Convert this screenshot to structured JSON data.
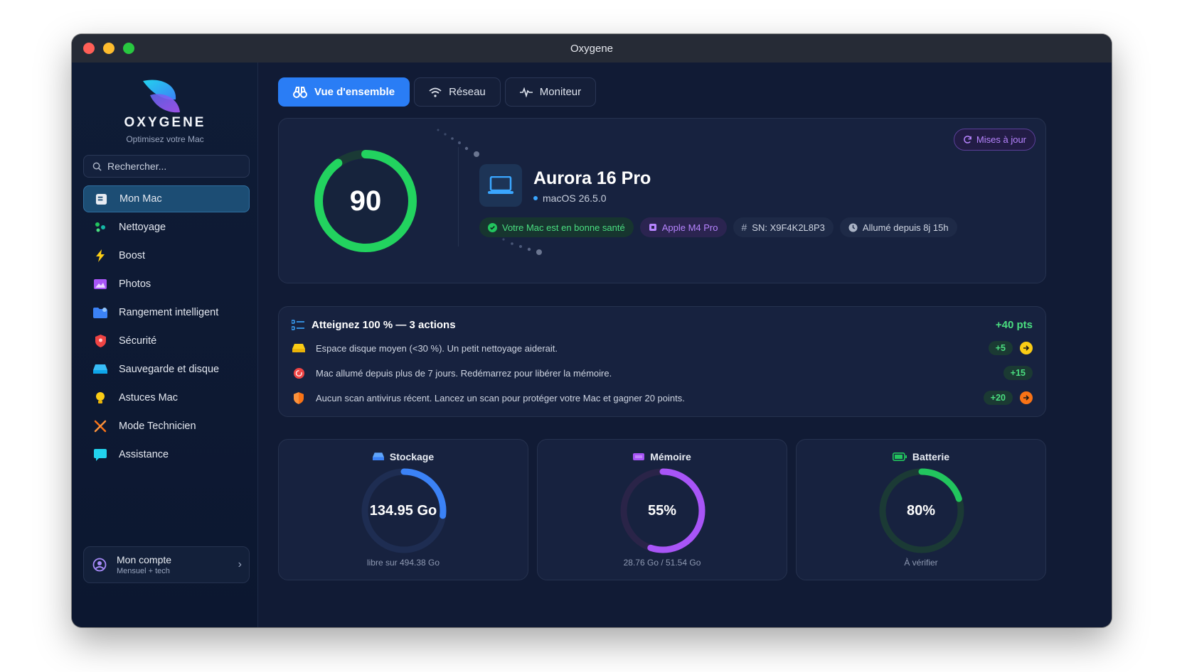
{
  "window": {
    "title": "Oxygene"
  },
  "sidebar": {
    "brand": "OXYGENE",
    "tagline": "Optimisez votre Mac",
    "search_placeholder": "Rechercher...",
    "items": [
      {
        "label": "Mon Mac",
        "icon": "mac-icon",
        "active": true
      },
      {
        "label": "Nettoyage",
        "icon": "sparkle-icon"
      },
      {
        "label": "Boost",
        "icon": "lightning-icon"
      },
      {
        "label": "Photos",
        "icon": "photo-icon"
      },
      {
        "label": "Rangement intelligent",
        "icon": "folder-icon"
      },
      {
        "label": "Sécurité",
        "icon": "shield-icon"
      },
      {
        "label": "Sauvegarde et disque",
        "icon": "disk-icon"
      },
      {
        "label": "Astuces Mac",
        "icon": "bulb-icon"
      },
      {
        "label": "Mode Technicien",
        "icon": "tools-icon"
      },
      {
        "label": "Assistance",
        "icon": "chat-icon"
      }
    ],
    "account": {
      "name": "Mon compte",
      "plan": "Mensuel + tech"
    }
  },
  "tabs": [
    {
      "label": "Vue d'ensemble",
      "active": true
    },
    {
      "label": "Réseau"
    },
    {
      "label": "Moniteur"
    }
  ],
  "hero": {
    "score": "90",
    "score_fraction": 0.9,
    "device_name": "Aurora 16 Pro",
    "os": "macOS 26.5.0",
    "update_label": "Mises à jour",
    "badges": {
      "health": "Votre Mac est en bonne santé",
      "chip": "Apple M4 Pro",
      "serial": "SN: X9F4K2L8P3",
      "uptime": "Allumé depuis 8j 15h"
    }
  },
  "actions": {
    "title": "Atteignez 100 % — 3 actions",
    "total_points": "+40 pts",
    "items": [
      {
        "text": "Espace disque moyen (<30 %). Un petit nettoyage aiderait.",
        "points": "+5"
      },
      {
        "text": "Mac allumé depuis plus de 7 jours. Redémarrez pour libérer la mémoire.",
        "points": "+15"
      },
      {
        "text": "Aucun scan antivirus récent. Lancez un scan pour protéger votre Mac et gagner 20 points.",
        "points": "+20"
      }
    ]
  },
  "cards": {
    "storage": {
      "title": "Stockage",
      "value": "134.95 Go",
      "sub": "libre sur 494.38 Go",
      "fraction": 0.27,
      "color": "#3b82f6"
    },
    "memory": {
      "title": "Mémoire",
      "value": "55%",
      "sub": "28.76 Go / 51.54 Go",
      "fraction": 0.55,
      "color": "#a855f7"
    },
    "battery": {
      "title": "Batterie",
      "value": "80%",
      "sub": "À vérifier",
      "fraction": 0.2,
      "color": "#22c55e"
    }
  },
  "colors": {
    "accent": "#2a7df5",
    "health": "#22d35f",
    "purple": "#b784ff"
  }
}
